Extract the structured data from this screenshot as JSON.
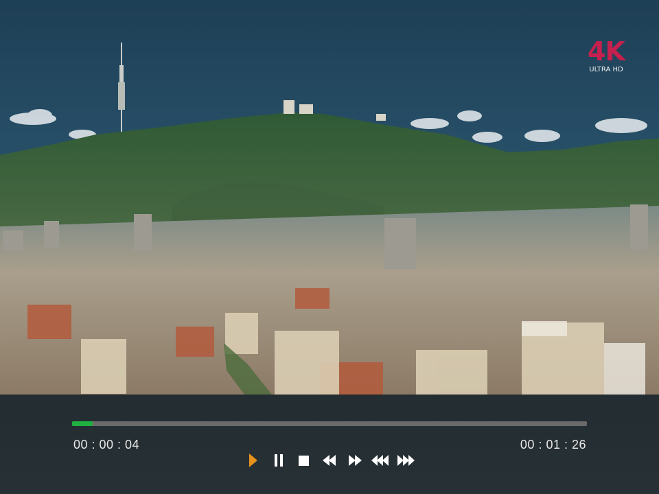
{
  "badge": {
    "main": "4K",
    "sub": "ULTRA HD"
  },
  "player": {
    "current_time": "00 : 00 : 04",
    "total_time": "00 : 01 : 26",
    "progress": 0.04,
    "accent_color": "#1fb040",
    "play_color": "#e8911c"
  },
  "controls": [
    {
      "name": "play-button",
      "icon": "play-icon"
    },
    {
      "name": "pause-button",
      "icon": "pause-icon"
    },
    {
      "name": "stop-button",
      "icon": "stop-icon"
    },
    {
      "name": "previous-button",
      "icon": "rewind-icon"
    },
    {
      "name": "next-button",
      "icon": "forward-icon"
    },
    {
      "name": "fast-rewind-button",
      "icon": "fast-rewind-icon"
    },
    {
      "name": "fast-forward-button",
      "icon": "fast-forward-icon"
    }
  ]
}
